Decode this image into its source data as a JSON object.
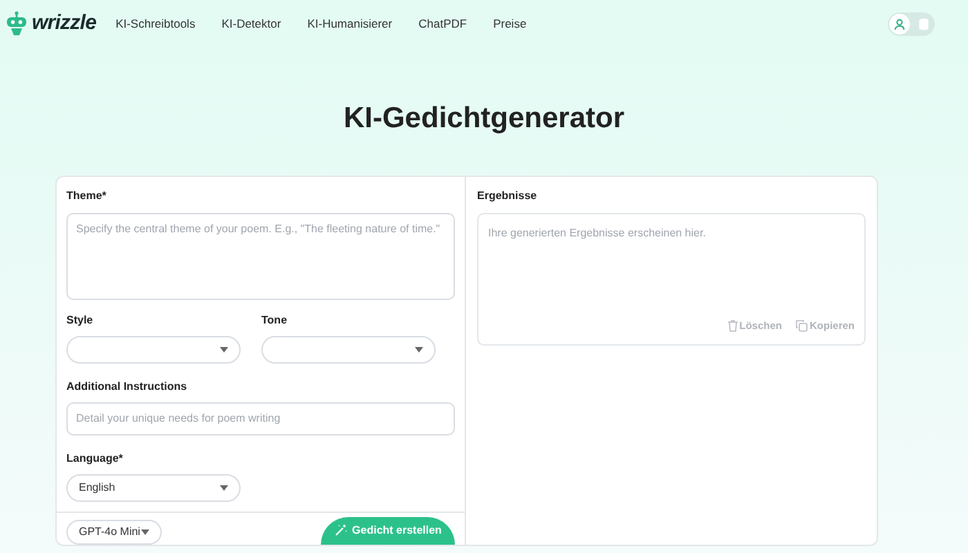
{
  "brand": {
    "name": "wrizzle"
  },
  "nav": [
    {
      "label": "KI-Schreibtools"
    },
    {
      "label": "KI-Detektor"
    },
    {
      "label": "KI-Humanisierer"
    },
    {
      "label": "ChatPDF"
    },
    {
      "label": "Preise"
    }
  ],
  "account_toggle": [
    {
      "kind": "user",
      "selected": true
    },
    {
      "kind": "database",
      "selected": false
    }
  ],
  "title": "KI-Gedichtgenerator",
  "form": {
    "theme": {
      "label": "Theme*",
      "placeholder": "Specify the central theme of your poem. E.g., \"The fleeting nature of time.\""
    },
    "style": {
      "label": "Style"
    },
    "tone": {
      "label": "Tone"
    },
    "instructions": {
      "label": "Additional Instructions",
      "placeholder": "Detail your unique needs for poem writing"
    },
    "language": {
      "label": "Language*",
      "value": "English"
    },
    "model": "GPT-4o Mini",
    "submit": "Gedicht erstellen"
  },
  "results": {
    "label": "Ergebnisse",
    "placeholder": "Ihre generierten Ergebnisse erscheinen hier.",
    "actions": [
      {
        "kind": "delete",
        "label": "Löschen"
      },
      {
        "kind": "copy",
        "label": "Kopieren"
      }
    ]
  }
}
